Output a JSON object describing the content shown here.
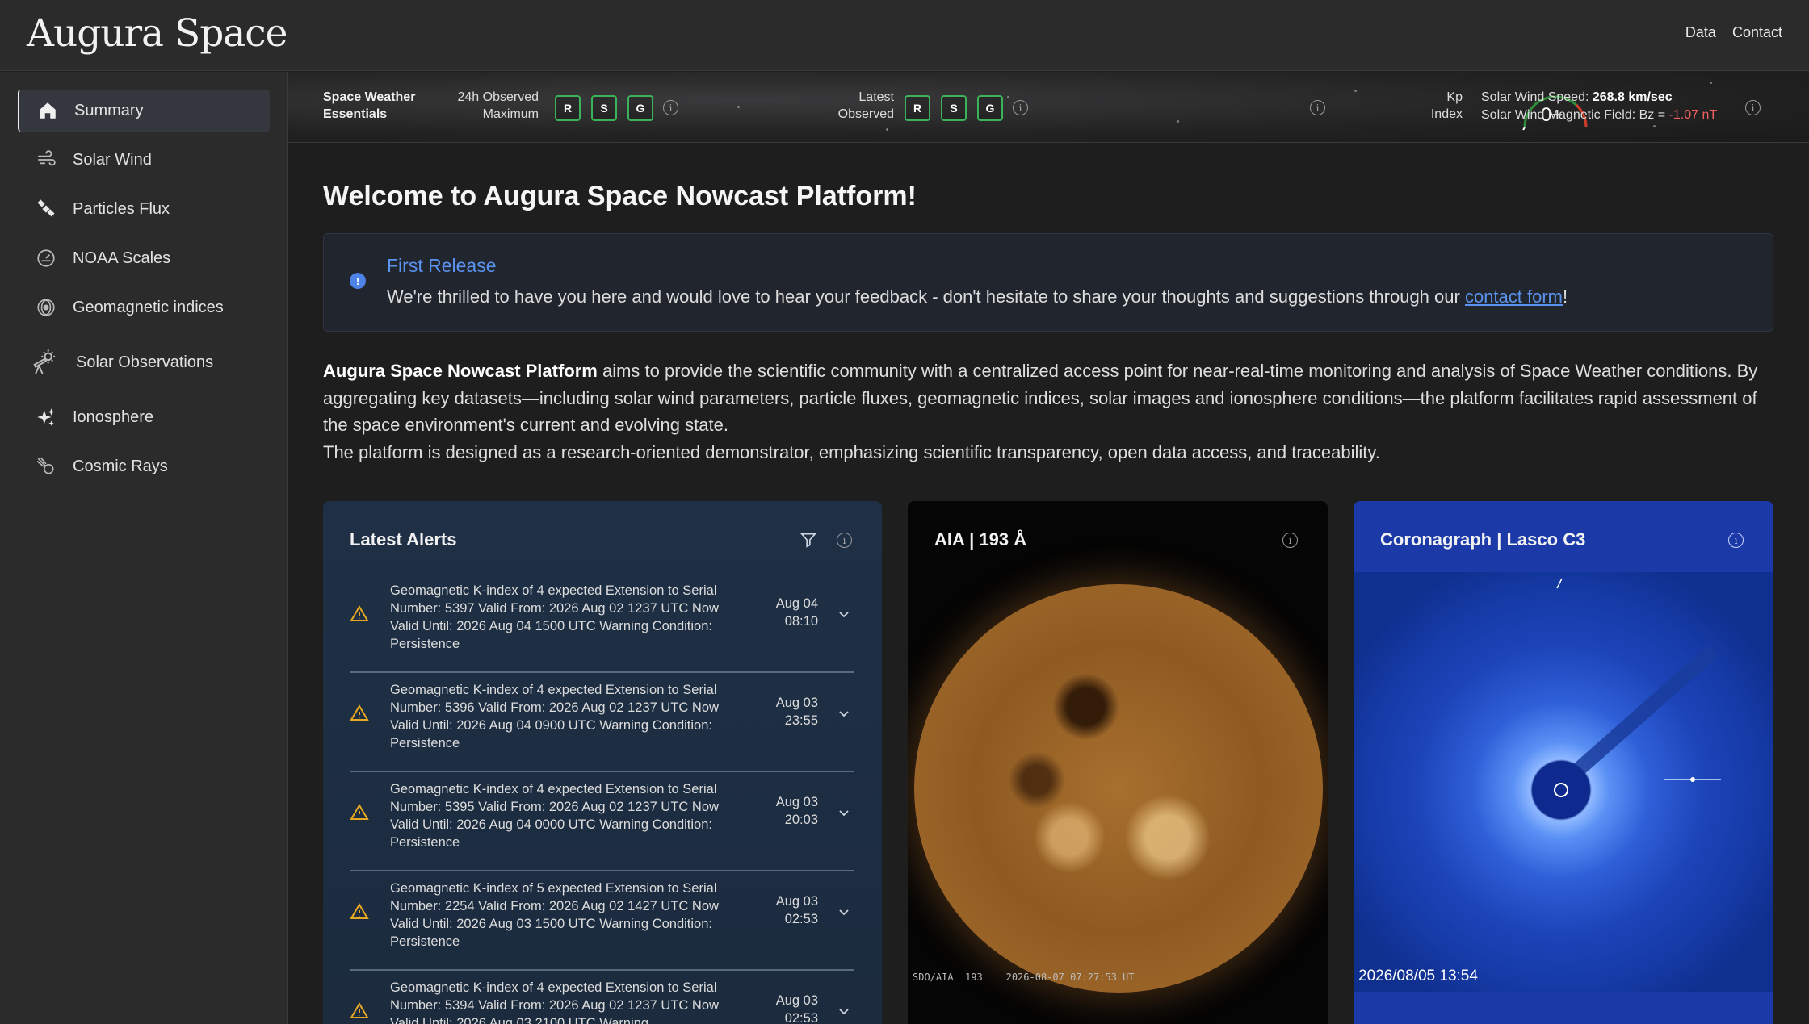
{
  "header": {
    "logo": "Augura Space",
    "nav": [
      "Data",
      "Contact"
    ]
  },
  "sidebar": {
    "items": [
      {
        "label": "Summary",
        "icon": "home-icon",
        "active": true
      },
      {
        "label": "Solar Wind",
        "icon": "wind-icon"
      },
      {
        "label": "Particles Flux",
        "icon": "satellite-icon"
      },
      {
        "label": "NOAA Scales",
        "icon": "gauge-icon"
      },
      {
        "label": "Geomagnetic indices",
        "icon": "magnet-field-icon"
      },
      {
        "label": "Solar Observations",
        "icon": "telescope-icon"
      },
      {
        "label": "Ionosphere",
        "icon": "sparkles-icon"
      },
      {
        "label": "Cosmic Rays",
        "icon": "comet-icon"
      }
    ]
  },
  "status": {
    "title_line1": "Space Weather",
    "title_line2": "Essentials",
    "observed_line1": "24h Observed",
    "observed_line2": "Maximum",
    "latest_line1": "Latest",
    "latest_line2": "Observed",
    "scales": [
      "R",
      "S",
      "G"
    ],
    "scale_color": "#3cb35a",
    "kp_line1": "Kp",
    "kp_line2": "Index",
    "kp_value": "0+",
    "wind_speed_label": "Solar Wind Speed:",
    "wind_speed_value": "268.8 km/sec",
    "bz_label": "Solar Wind Magnetic Field: Bz = ",
    "bz_value": "-1.07 nT",
    "info": "i"
  },
  "main": {
    "title": "Welcome to Augura Space Nowcast Platform!",
    "release_icon": "!",
    "release_title": "First Release",
    "release_text": "We're thrilled to have you here and would love to hear your feedback - don't hesitate to share your thoughts and suggestions through our ",
    "release_link": "contact form",
    "release_end": "!",
    "intro_bold": "Augura Space Nowcast Platform",
    "intro_1": " aims to provide the scientific community with a centralized access point for near-real-time monitoring and analysis of Space Weather conditions. By aggregating key datasets—including solar wind parameters, particle fluxes, geomagnetic indices, solar images and ionosphere conditions—the platform facilitates rapid assessment of the space environment's current and evolving state.",
    "intro_2": "The platform is designed as a research-oriented demonstrator, emphasizing scientific transparency, open data access, and traceability."
  },
  "alerts": {
    "title": "Latest Alerts",
    "items": [
      {
        "text": "Geomagnetic K-index of 4 expected Extension to Serial Number: 5397 Valid From: 2026 Aug 02 1237 UTC Now Valid Until: 2026 Aug 04 1500 UTC Warning Condition: Persistence",
        "date": "Aug 04",
        "time": "08:10"
      },
      {
        "text": "Geomagnetic K-index of 4 expected Extension to Serial Number: 5396 Valid From: 2026 Aug 02 1237 UTC Now Valid Until: 2026 Aug 04 0900 UTC Warning Condition: Persistence",
        "date": "Aug 03",
        "time": "23:55"
      },
      {
        "text": "Geomagnetic K-index of 4 expected Extension to Serial Number: 5395 Valid From: 2026 Aug 02 1237 UTC Now Valid Until: 2026 Aug 04 0000 UTC Warning Condition: Persistence",
        "date": "Aug 03",
        "time": "20:03"
      },
      {
        "text": "Geomagnetic K-index of 5 expected Extension to Serial Number: 2254 Valid From: 2026 Aug 02 1427 UTC Now Valid Until: 2026 Aug 03 1500 UTC Warning Condition: Persistence",
        "date": "Aug 03",
        "time": "02:53"
      },
      {
        "text": "Geomagnetic K-index of 4 expected Extension to Serial Number: 5394 Valid From: 2026 Aug 02 1237 UTC Now Valid Until: 2026 Aug 03 2100 UTC Warning",
        "date": "Aug 03",
        "time": "02:53"
      }
    ]
  },
  "aia": {
    "title": "AIA | 193 Å",
    "caption": "SDO/AIA  193    2026-08-07 07:27:53 UT"
  },
  "lasco": {
    "title": "Coronagraph | Lasco C3",
    "timestamp": "2026/08/05  13:54"
  }
}
